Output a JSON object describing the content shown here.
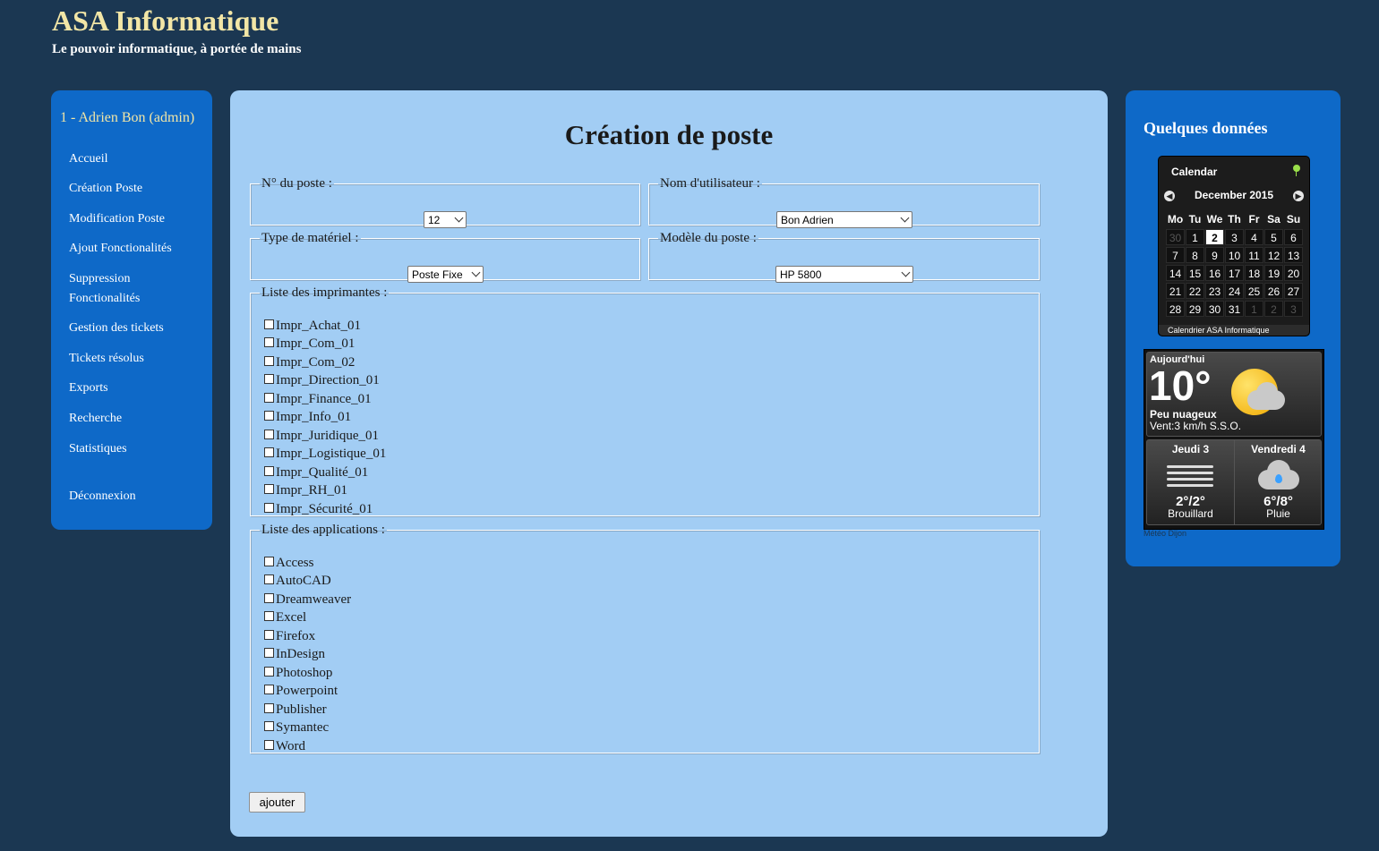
{
  "site": {
    "title": "ASA Informatique",
    "tagline": "Le pouvoir informatique, à portée de mains"
  },
  "sidebar": {
    "user": "1 - Adrien Bon (admin)",
    "items": [
      {
        "label": "Accueil"
      },
      {
        "label": "Création Poste"
      },
      {
        "label": "Modification Poste"
      },
      {
        "label": "Ajout Fonctionalités"
      },
      {
        "label": "Suppression Fonctionalités"
      },
      {
        "label": "Gestion des tickets"
      },
      {
        "label": "Tickets résolus"
      },
      {
        "label": "Exports"
      },
      {
        "label": "Recherche"
      },
      {
        "label": "Statistiques"
      }
    ],
    "logout": "Déconnexion"
  },
  "main": {
    "title": "Création de poste",
    "fields": {
      "poste_num": {
        "legend": "N° du poste :",
        "value": "12"
      },
      "user_name": {
        "legend": "Nom d'utilisateur :",
        "value": "Bon Adrien"
      },
      "material_type": {
        "legend": "Type de matériel :",
        "value": "Poste Fixe"
      },
      "model": {
        "legend": "Modèle du poste :",
        "value": "HP 5800"
      }
    },
    "printers": {
      "legend": "Liste des imprimantes :",
      "items": [
        "Impr_Achat_01",
        "Impr_Com_01",
        "Impr_Com_02",
        "Impr_Direction_01",
        "Impr_Finance_01",
        "Impr_Info_01",
        "Impr_Juridique_01",
        "Impr_Logistique_01",
        "Impr_Qualité_01",
        "Impr_RH_01",
        "Impr_Sécurité_01"
      ]
    },
    "applications": {
      "legend": "Liste des applications :",
      "items": [
        "Access",
        "AutoCAD",
        "Dreamweaver",
        "Excel",
        "Firefox",
        "InDesign",
        "Photoshop",
        "Powerpoint",
        "Publisher",
        "Symantec",
        "Word"
      ]
    },
    "submit_label": "ajouter"
  },
  "right": {
    "title": "Quelques données",
    "calendar": {
      "header": "Calendar",
      "month": "December 2015",
      "weekdays": [
        "Mo",
        "Tu",
        "We",
        "Th",
        "Fr",
        "Sa",
        "Su"
      ],
      "days": [
        {
          "d": "30",
          "other": true
        },
        {
          "d": "1"
        },
        {
          "d": "2",
          "today": true
        },
        {
          "d": "3"
        },
        {
          "d": "4"
        },
        {
          "d": "5"
        },
        {
          "d": "6"
        },
        {
          "d": "7"
        },
        {
          "d": "8"
        },
        {
          "d": "9"
        },
        {
          "d": "10"
        },
        {
          "d": "11"
        },
        {
          "d": "12"
        },
        {
          "d": "13"
        },
        {
          "d": "14"
        },
        {
          "d": "15"
        },
        {
          "d": "16"
        },
        {
          "d": "17"
        },
        {
          "d": "18"
        },
        {
          "d": "19"
        },
        {
          "d": "20"
        },
        {
          "d": "21"
        },
        {
          "d": "22"
        },
        {
          "d": "23"
        },
        {
          "d": "24"
        },
        {
          "d": "25"
        },
        {
          "d": "26"
        },
        {
          "d": "27"
        },
        {
          "d": "28"
        },
        {
          "d": "29"
        },
        {
          "d": "30"
        },
        {
          "d": "31"
        },
        {
          "d": "1",
          "other": true
        },
        {
          "d": "2",
          "other": true
        },
        {
          "d": "3",
          "other": true
        }
      ],
      "footer": "Calendrier ASA Informatique"
    },
    "weather": {
      "today_label": "Aujourd'hui",
      "temp": "10°",
      "condition": "Peu nuageux",
      "wind": "Vent:3 km/h S.S.O.",
      "forecast": [
        {
          "day": "Jeudi 3",
          "temp": "2°/2°",
          "cond": "Brouillard",
          "icon": "fog-icon"
        },
        {
          "day": "Vendredi 4",
          "temp": "6°/8°",
          "cond": "Pluie",
          "icon": "rain-icon"
        }
      ],
      "footer": "Météo Dijon"
    }
  }
}
